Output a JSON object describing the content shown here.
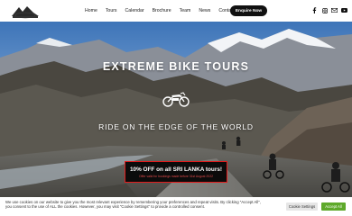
{
  "header": {
    "logo_alt": "Extreme Bike Tours logo",
    "nav": [
      "Home",
      "Tours",
      "Calendar",
      "Brochure",
      "Team",
      "News",
      "Contacts"
    ],
    "enquire_label": "Enquire Now",
    "social_icons": [
      "facebook-icon",
      "instagram-icon",
      "email-icon",
      "youtube-icon"
    ]
  },
  "hero": {
    "title": "EXTREME BIKE TOURS",
    "subtitle": "RIDE ON THE EDGE OF THE WORLD"
  },
  "promo": {
    "title": "10% OFF on all SRI LANKA tours!",
    "subtitle": "Offer valid for bookings made before 31st August 2022"
  },
  "cookie": {
    "text": "We use cookies on our website to give you the most relevant experience by remembering your preferences and repeat visits. By clicking \"Accept All\", you consent to the use of ALL the cookies. However, you may visit \"Cookie Settings\" to provide a controlled consent.",
    "settings_label": "Cookie Settings",
    "accept_label": "Accept All"
  },
  "colors": {
    "accent_green": "#5ea92b",
    "promo_border": "#e21b1b",
    "dark": "#111111"
  }
}
